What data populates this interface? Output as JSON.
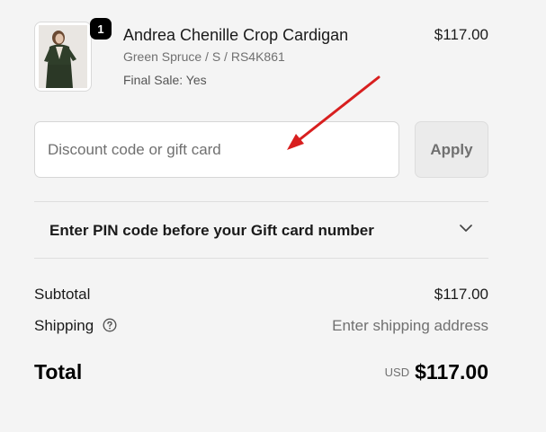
{
  "product": {
    "title": "Andrea Chenille Crop Cardigan",
    "variant": "Green Spruce / S / RS4K861",
    "final_sale": "Final Sale: Yes",
    "price": "$117.00",
    "quantity": "1",
    "image_icon": "product-photo"
  },
  "discount": {
    "placeholder": "Discount code or gift card",
    "value": "",
    "apply_label": "Apply"
  },
  "gift_card_pin": {
    "label": "Enter PIN code before your Gift card number",
    "icon": "chevron-down-icon"
  },
  "summary": {
    "subtotal_label": "Subtotal",
    "subtotal_value": "$117.00",
    "shipping_label": "Shipping",
    "shipping_value": "Enter shipping address",
    "total_label": "Total",
    "currency": "USD",
    "total_value": "$117.00"
  },
  "colors": {
    "annotation_arrow": "#d81f1f",
    "background": "#f4f4f4",
    "garment": "#2f3e2a"
  }
}
